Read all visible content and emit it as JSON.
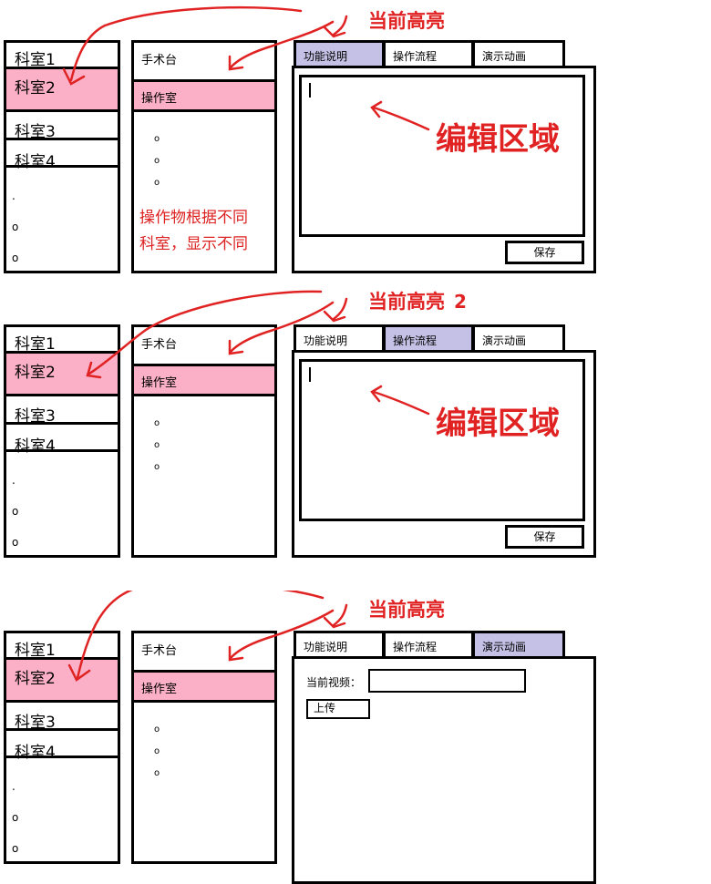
{
  "panels": [
    {
      "departments": [
        "科室1",
        "科室2",
        "科室3",
        "科室4"
      ],
      "room_title": "手术台",
      "room_selected": "操作室",
      "note_lines": [
        "操作物根据不同",
        "科室，显示不同"
      ],
      "tabs": [
        "功能说明",
        "操作流程",
        "演示动画"
      ],
      "active_tab": 0,
      "save_label": "保存",
      "highlight_note": "当前高亮",
      "edit_note": "编辑区域"
    },
    {
      "departments": [
        "科室1",
        "科室2",
        "科室3",
        "科室4"
      ],
      "room_title": "手术台",
      "room_selected": "操作室",
      "tabs": [
        "功能说明",
        "操作流程",
        "演示动画"
      ],
      "active_tab": 1,
      "save_label": "保存",
      "highlight_note": "当前高亮",
      "edit_note": "编辑区域"
    },
    {
      "departments": [
        "科室1",
        "科室2",
        "科室3",
        "科室4"
      ],
      "room_title": "手术台",
      "room_selected": "操作室",
      "tabs": [
        "功能说明",
        "操作流程",
        "演示动画"
      ],
      "active_tab": 2,
      "video_label": "当前视频：",
      "upload_label": "上传",
      "highlight_note": "当前高亮"
    }
  ],
  "colors": {
    "highlight": "#fbb0c8",
    "active_tab": "#c5c1e6",
    "annotation": "#e02222"
  }
}
